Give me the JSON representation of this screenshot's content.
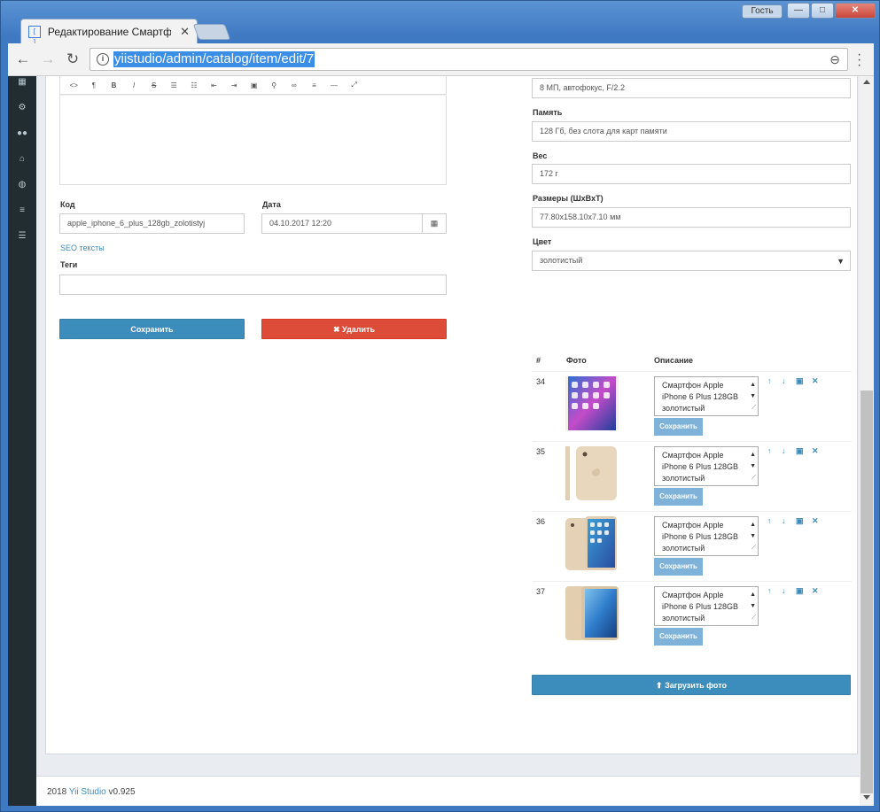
{
  "browser": {
    "tab_title": "Редактирование Смартф",
    "tab_close": "✕",
    "guest_label": "Гость",
    "url": "yiistudio/admin/catalog/item/edit/7",
    "window_min": "—",
    "window_max": "□",
    "window_close": "✕"
  },
  "sidebar": {
    "icons": [
      "dashboard-icon",
      "gear-icon",
      "users-icon",
      "inbox-icon",
      "globe-icon",
      "list-icon",
      "database-icon"
    ]
  },
  "form": {
    "code_label": "Код",
    "code_value": "apple_iphone_6_plus_128gb_zolotistyj",
    "date_label": "Дата",
    "date_value": "04.10.2017 12:20",
    "seo_link": "SEO тексты",
    "tags_label": "Теги",
    "tags_value": "",
    "save_button": "Сохранить",
    "delete_button": "✖ Удалить"
  },
  "specs": {
    "camera_value": "8 МП, автофокус, F/2.2",
    "memory_label": "Память",
    "memory_value": "128 Гб, без слота для карт памяти",
    "weight_label": "Вес",
    "weight_value": "172 г",
    "size_label": "Размеры (ШxВxТ)",
    "size_value": "77.80x158.10x7.10 мм",
    "color_label": "Цвет",
    "color_value": "золотистый"
  },
  "photos": {
    "col_num": "#",
    "col_photo": "Фото",
    "col_desc": "Описание",
    "rows": [
      {
        "id": "34",
        "description": "Смартфон Apple iPhone 6 Plus 128GB золотистый",
        "save": "Сохранить"
      },
      {
        "id": "35",
        "description": "Смартфон Apple iPhone 6 Plus 128GB золотистый",
        "save": "Сохранить"
      },
      {
        "id": "36",
        "description": "Смартфон Apple iPhone 6 Plus 128GB золотистый",
        "save": "Сохранить"
      },
      {
        "id": "37",
        "description": "Смартфон Apple iPhone 6 Plus 128GB золотистый",
        "save": "Сохранить"
      }
    ],
    "upload_button": "Загрузить фото"
  },
  "footer": {
    "year": "2018",
    "brand": "Yii Studio",
    "version": "v0.925"
  }
}
